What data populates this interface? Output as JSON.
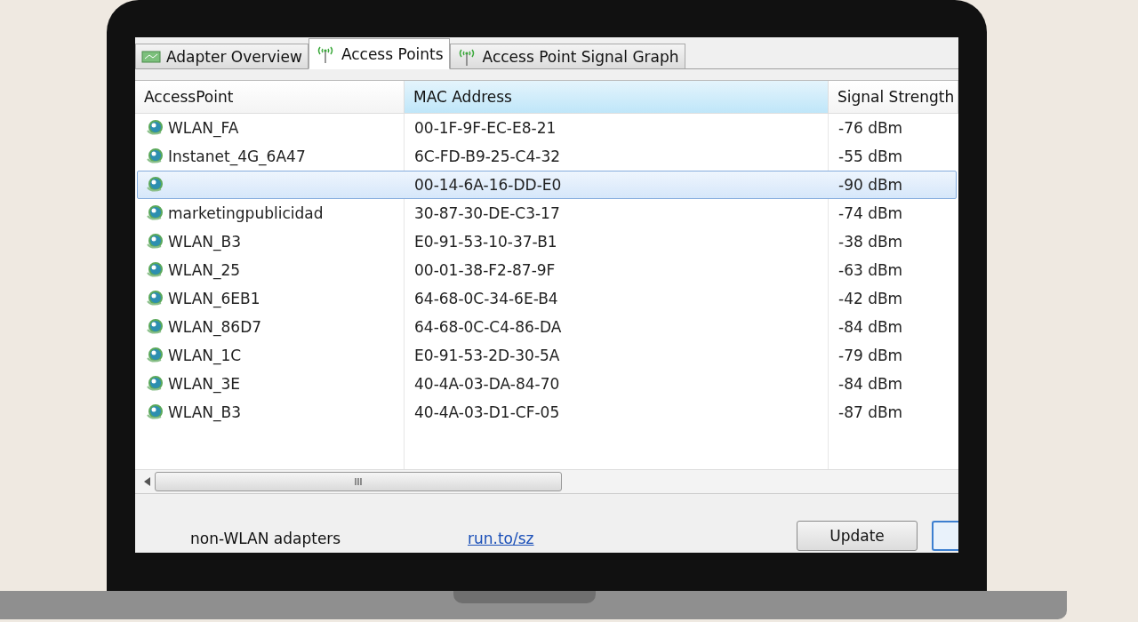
{
  "tabs": [
    {
      "label": "Adapter Overview",
      "kind": "adapter",
      "selected": false
    },
    {
      "label": "Access Points",
      "kind": "antenna",
      "selected": true
    },
    {
      "label": "Access Point Signal Graph",
      "kind": "antenna",
      "selected": false
    }
  ],
  "table": {
    "columns": [
      {
        "label": "AccessPoint",
        "highlighted": false
      },
      {
        "label": "MAC Address",
        "highlighted": true
      },
      {
        "label": "Signal Strength",
        "highlighted": false
      }
    ],
    "rows": [
      {
        "name": "WLAN_FA",
        "mac": "00-1F-9F-EC-E8-21",
        "signal": "-76 dBm",
        "selected": false
      },
      {
        "name": "Instanet_4G_6A47",
        "mac": "6C-FD-B9-25-C4-32",
        "signal": "-55 dBm",
        "selected": false
      },
      {
        "mac": "00-14-6A-16-DD-E0",
        "signal": "-90 dBm",
        "selected": true
      },
      {
        "name": "marketingpublicidad",
        "mac": "30-87-30-DE-C3-17",
        "signal": "-74 dBm",
        "selected": false
      },
      {
        "name": "WLAN_B3",
        "mac": "E0-91-53-10-37-B1",
        "signal": "-38 dBm",
        "selected": false
      },
      {
        "name": "WLAN_25",
        "mac": "00-01-38-F2-87-9F",
        "signal": "-63 dBm",
        "selected": false
      },
      {
        "name": "WLAN_6EB1",
        "mac": "64-68-0C-34-6E-B4",
        "signal": "-42 dBm",
        "selected": false
      },
      {
        "name": "WLAN_86D7",
        "mac": "64-68-0C-C4-86-DA",
        "signal": "-84 dBm",
        "selected": false
      },
      {
        "name": "WLAN_1C",
        "mac": "E0-91-53-2D-30-5A",
        "signal": "-79 dBm",
        "selected": false
      },
      {
        "name": "WLAN_3E",
        "mac": "40-4A-03-DA-84-70",
        "signal": "-84 dBm",
        "selected": false
      },
      {
        "name": "WLAN_B3",
        "mac": "40-4A-03-D1-CF-05",
        "signal": "-87 dBm",
        "selected": false
      }
    ],
    "scroll_grip": "III"
  },
  "footer": {
    "option_label": "non-WLAN adapters",
    "link": "run.to/sz",
    "buttons": [
      "Update"
    ]
  }
}
